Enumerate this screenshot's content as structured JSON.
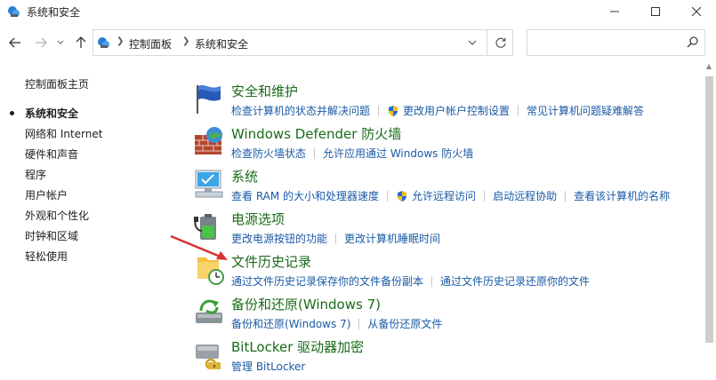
{
  "window": {
    "title": "系统和安全"
  },
  "nav": {
    "breadcrumb": [
      "控制面板",
      "系统和安全"
    ],
    "search_placeholder": ""
  },
  "sidebar": {
    "items": [
      {
        "label": "控制面板主页"
      },
      {
        "label": "系统和安全",
        "selected": true
      },
      {
        "label": "网络和 Internet"
      },
      {
        "label": "硬件和声音"
      },
      {
        "label": "程序"
      },
      {
        "label": "用户帐户"
      },
      {
        "label": "外观和个性化"
      },
      {
        "label": "时钟和区域"
      },
      {
        "label": "轻松使用"
      }
    ]
  },
  "categories": [
    {
      "title": "安全和维护",
      "icon": "security-flag-icon",
      "links": [
        "检查计算机的状态并解决问题",
        "更改用户帐户控制设置",
        "常见计算机问题疑难解答"
      ]
    },
    {
      "title": "Windows Defender 防火墙",
      "icon": "firewall-icon",
      "links": [
        "检查防火墙状态",
        "允许应用通过 Windows 防火墙"
      ]
    },
    {
      "title": "系统",
      "icon": "system-monitor-icon",
      "links": [
        "查看 RAM 的大小和处理器速度",
        "允许远程访问",
        "启动远程协助",
        "查看该计算机的名称"
      ]
    },
    {
      "title": "电源选项",
      "icon": "power-battery-icon",
      "links": [
        "更改电源按钮的功能",
        "更改计算机睡眠时间"
      ]
    },
    {
      "title": "文件历史记录",
      "icon": "file-history-icon",
      "links": [
        "通过文件历史记录保存你的文件备份副本",
        "通过文件历史记录还原你的文件"
      ]
    },
    {
      "title": "备份和还原(Windows 7)",
      "icon": "backup-restore-icon",
      "links": [
        "备份和还原(Windows 7)",
        "从备份还原文件"
      ]
    },
    {
      "title": "BitLocker 驱动器加密",
      "icon": "bitlocker-icon",
      "links": [
        "管理 BitLocker"
      ]
    }
  ],
  "colors": {
    "category_title": "#1a6b1a",
    "link": "#1a5aa6",
    "annotation_arrow": "#d93030"
  }
}
